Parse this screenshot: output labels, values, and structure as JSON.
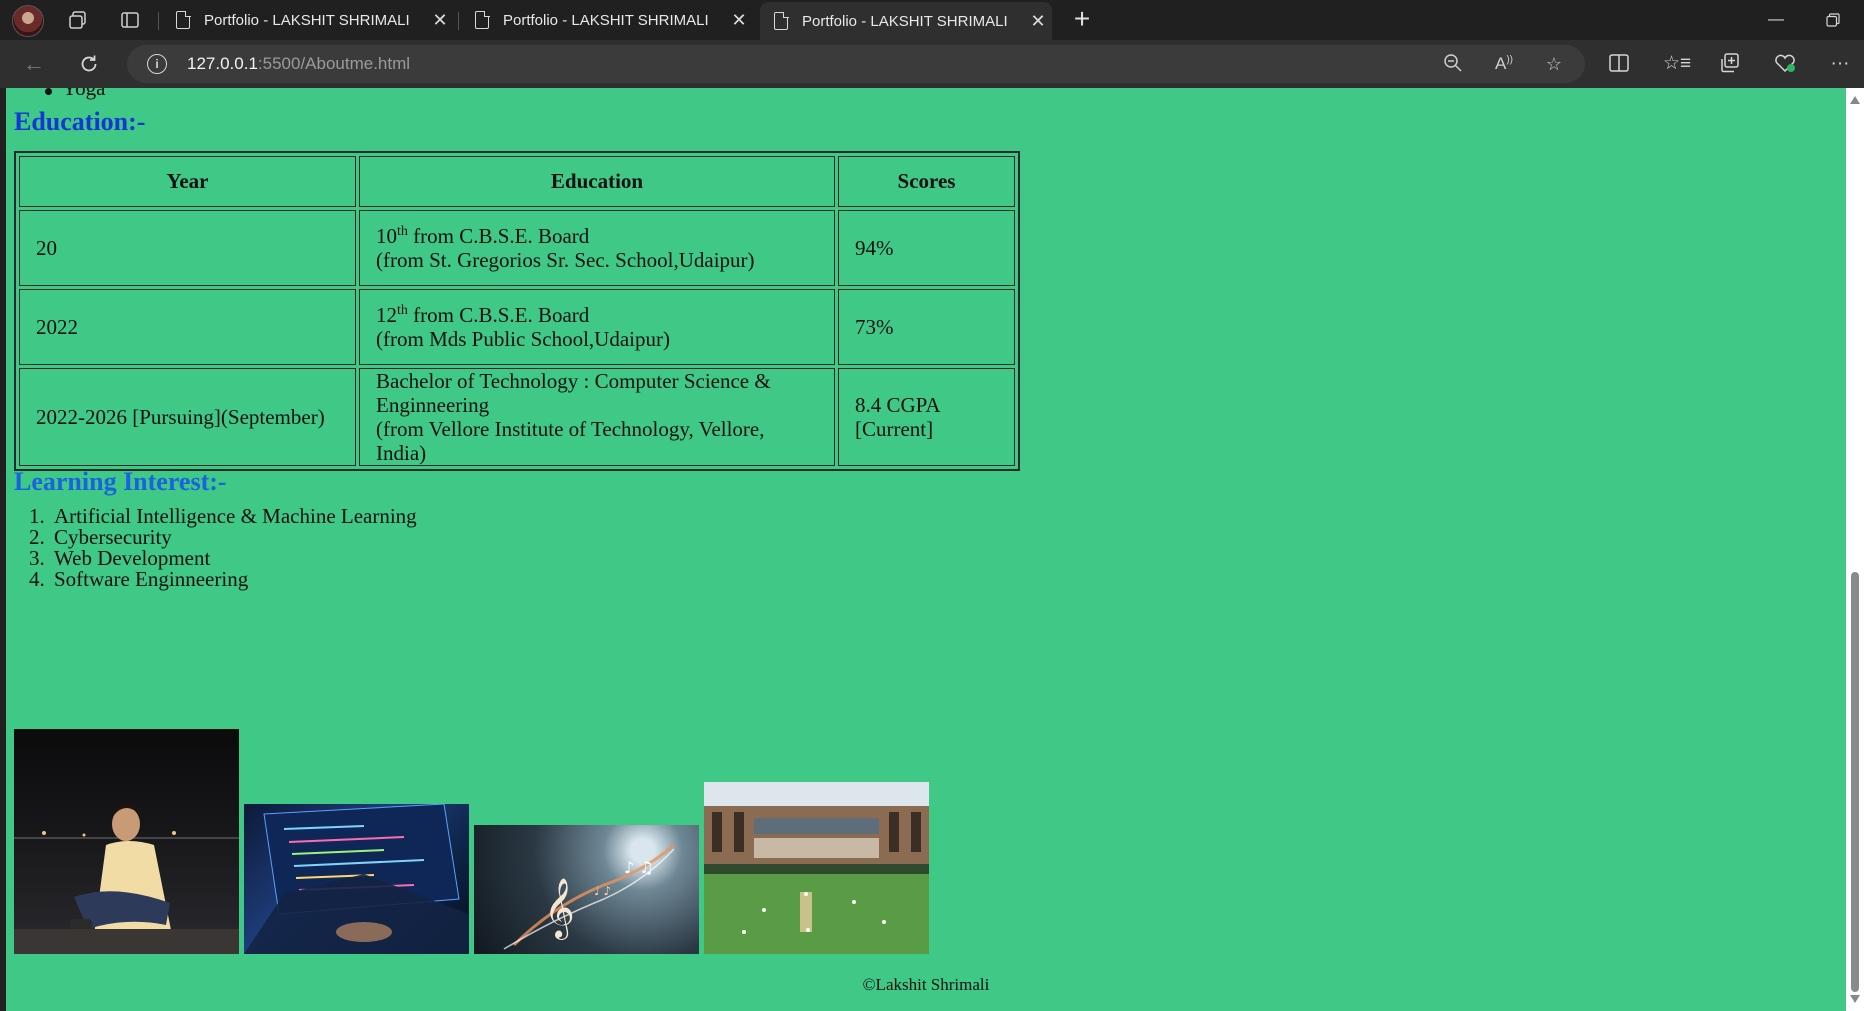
{
  "browser": {
    "tabs": [
      {
        "title": "Portfolio - LAKSHIT SHRIMALI",
        "active": false
      },
      {
        "title": "Portfolio - LAKSHIT SHRIMALI",
        "active": false
      },
      {
        "title": "Portfolio - LAKSHIT SHRIMALI",
        "active": true
      }
    ],
    "url_host": "127.0.0.1",
    "url_path": ":5500/Aboutme.html",
    "icons": [
      "back-icon",
      "refresh-icon",
      "info-icon",
      "zoom-out-icon",
      "read-aloud-icon",
      "favorite-star-icon",
      "split-screen-icon",
      "favorites-icon",
      "collections-icon",
      "browser-essentials-icon",
      "more-icon"
    ]
  },
  "page": {
    "hobby_last": "Yoga",
    "education_heading": "Education:-",
    "table": {
      "headers": [
        "Year",
        "Education",
        "Scores"
      ],
      "rows": [
        {
          "year": "20",
          "edu_main": "10",
          "edu_sup": "th",
          "edu_rest": " from C.B.S.E. Board",
          "edu_sub": "(from St. Gregorios Sr. Sec. School,Udaipur)",
          "score": "94%"
        },
        {
          "year": "2022",
          "edu_main": "12",
          "edu_sup": "th",
          "edu_rest": " from C.B.S.E. Board",
          "edu_sub": "(from Mds Public School,Udaipur)",
          "score": "73%"
        },
        {
          "year": "2022-2026 [Pursuing](September)",
          "edu_main": "Bachelor of Technology : Computer Science & Enginneering",
          "edu_sup": "",
          "edu_rest": "",
          "edu_sub": "(from Vellore Institute of Technology, Vellore, India)",
          "score": "8.4 CGPA [Current]"
        }
      ]
    },
    "learning_heading": "Learning Interest:-",
    "interests": [
      "Artificial Intelligence & Machine Learning",
      "Cybersecurity",
      "Web Development",
      "Software Enginneering"
    ],
    "footer": "©Lakshit Shrimali"
  },
  "colors": {
    "page_bg": "#40c886",
    "education_heading": "#1636d6",
    "learning_heading": "#1a63e0",
    "browser_chrome": "#202020"
  }
}
